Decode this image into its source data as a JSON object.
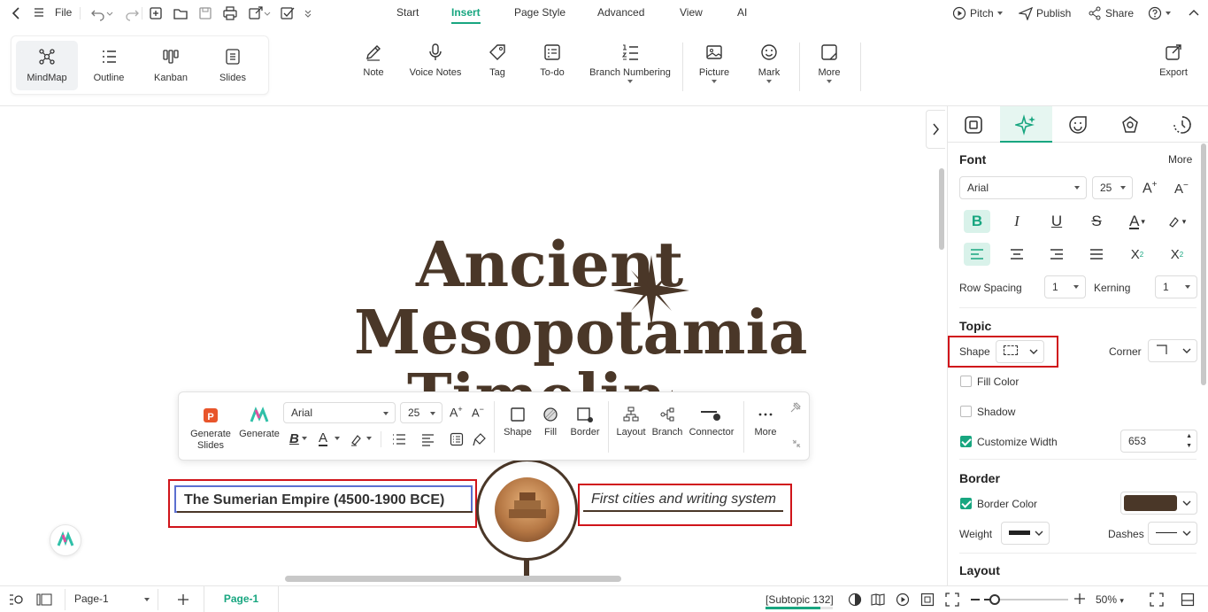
{
  "topbar": {
    "file_label": "File",
    "menu_tabs": [
      "Start",
      "Insert",
      "Page Style",
      "Advanced",
      "View",
      "AI"
    ],
    "active_tab": "Insert",
    "pitch_label": "Pitch",
    "publish_label": "Publish",
    "share_label": "Share"
  },
  "ribbon": {
    "views": [
      "MindMap",
      "Outline",
      "Kanban",
      "Slides"
    ],
    "active_view": "MindMap",
    "tools": [
      "Note",
      "Voice Notes",
      "Tag",
      "To-do",
      "Branch Numbering",
      "Picture",
      "Mark",
      "More"
    ],
    "export_label": "Export"
  },
  "canvas": {
    "title_line1": "Ancient",
    "title_line2": "Mesopotamia",
    "title_line3": "Timeline",
    "topic_text": "The Sumerian Empire (4500-1900 BCE)",
    "subtopic_text": "First cities and writing system"
  },
  "floating_toolbar": {
    "generate_slides_label": "Generate\nSlides",
    "generate_label": "Generate",
    "font": "Arial",
    "font_size": "25",
    "shape_label": "Shape",
    "fill_label": "Fill",
    "border_label": "Border",
    "layout_label": "Layout",
    "branch_label": "Branch",
    "connector_label": "Connector",
    "more_label": "More"
  },
  "panel": {
    "font_section": "Font",
    "more_label": "More",
    "font_family": "Arial",
    "font_size": "25",
    "row_spacing_label": "Row Spacing",
    "row_spacing_value": "1",
    "kerning_label": "Kerning",
    "kerning_value": "1",
    "topic_section": "Topic",
    "shape_label": "Shape",
    "corner_label": "Corner",
    "fill_color_label": "Fill Color",
    "fill_color_checked": false,
    "shadow_label": "Shadow",
    "shadow_checked": false,
    "customize_width_label": "Customize Width",
    "customize_width_checked": true,
    "customize_width_value": "653",
    "border_section": "Border",
    "border_color_label": "Border Color",
    "border_color_checked": true,
    "border_color_value": "#4a3728",
    "weight_label": "Weight",
    "dashes_label": "Dashes",
    "layout_section": "Layout"
  },
  "statusbar": {
    "page_select": "Page-1",
    "page_tab": "Page-1",
    "selection_info": "[Subtopic 132]",
    "zoom": "50%"
  },
  "colors": {
    "accent": "#18a680",
    "highlight": "#d0141a",
    "title_brown": "#4a3728"
  }
}
